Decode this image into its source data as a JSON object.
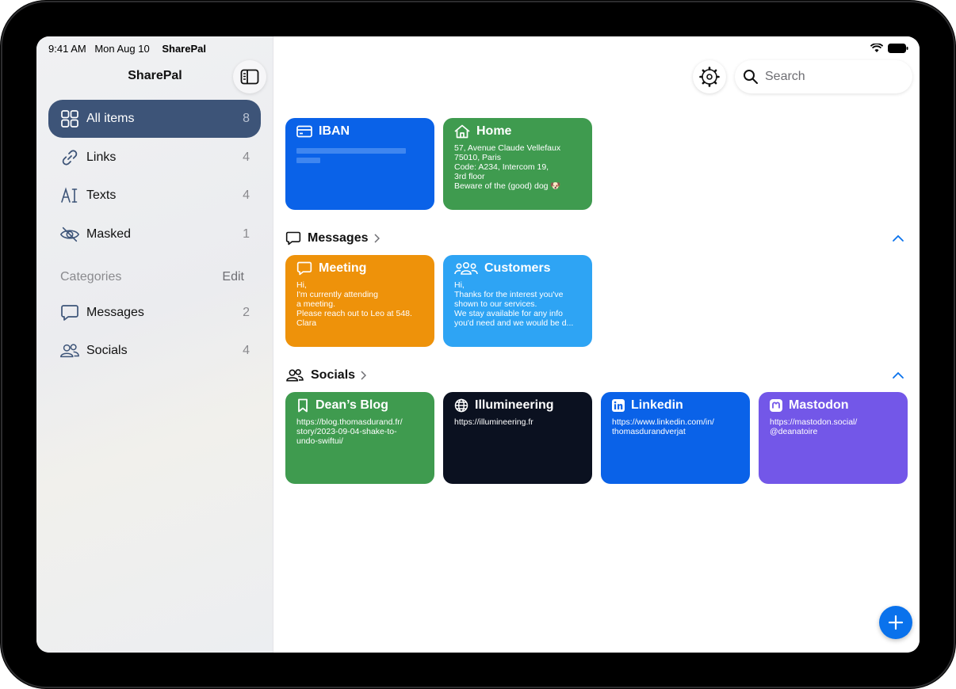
{
  "status_bar": {
    "time": "9:41 AM",
    "date": "Mon Aug 10",
    "app": "SharePal"
  },
  "sidebar": {
    "title": "SharePal",
    "items": [
      {
        "label": "All items",
        "count": "8",
        "icon": "grid-icon",
        "selected": true
      },
      {
        "label": "Links",
        "count": "4",
        "icon": "link-icon"
      },
      {
        "label": "Texts",
        "count": "4",
        "icon": "text-cursor-icon"
      },
      {
        "label": "Masked",
        "count": "1",
        "icon": "eye-slash-icon"
      }
    ],
    "categories_label": "Categories",
    "edit_label": "Edit",
    "categories": [
      {
        "label": "Messages",
        "count": "2",
        "icon": "message-bubble-icon"
      },
      {
        "label": "Socials",
        "count": "4",
        "icon": "people-icon"
      }
    ]
  },
  "toolbar": {
    "search_placeholder": "Search"
  },
  "cards_top": [
    {
      "title": "IBAN",
      "body": "",
      "color": "#0a62e8",
      "icon": "credit-card-icon",
      "masked": true
    },
    {
      "title": "Home",
      "body": "57, Avenue Claude Vellefaux\n75010, Paris\nCode: A234, Intercom 19,\n3rd floor\nBeware of the (good) dog 🐶",
      "color": "#3f9b4f",
      "icon": "house-icon"
    }
  ],
  "sections": [
    {
      "title": "Messages",
      "icon": "message-bubble-icon",
      "cards": [
        {
          "title": "Meeting",
          "body": "Hi,\nI'm currently attending\na meeting.\nPlease reach out to Leo at 548.\nClara",
          "color": "#ee920a",
          "icon": "message-bubble-icon"
        },
        {
          "title": "Customers",
          "body": "Hi,\nThanks for the interest you've\nshown to our services.\nWe stay available for any info\nyou'd need and we would be d...",
          "color": "#2ea4f4",
          "icon": "people-group-icon"
        }
      ]
    },
    {
      "title": "Socials",
      "icon": "people-icon",
      "cards": [
        {
          "title": "Dean’s Blog",
          "body": "https://blog.thomasdurand.fr/\nstory/2023-09-04-shake-to-\nundo-swiftui/",
          "color": "#3f9b4f",
          "icon": "bookmark-icon"
        },
        {
          "title": "Illumineering",
          "body": "https://illumineering.fr",
          "color": "#0b1120",
          "icon": "globe-icon"
        },
        {
          "title": "Linkedin",
          "body": "https://www.linkedin.com/in/\nthomasdurandverjat",
          "color": "#0a62e8",
          "icon": "linkedin-icon"
        },
        {
          "title": "Mastodon",
          "body": "https://mastodon.social/\n@deanatoire",
          "color": "#7357e8",
          "icon": "mastodon-icon"
        }
      ]
    }
  ]
}
